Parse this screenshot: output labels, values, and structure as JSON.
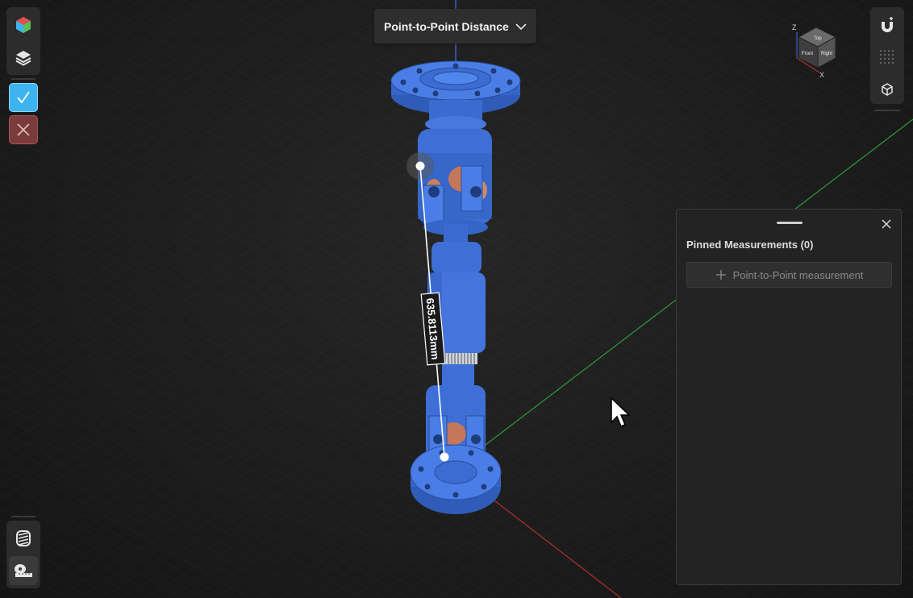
{
  "mode_dropdown": {
    "label": "Point-to-Point Distance",
    "icon": "chevron-down-icon"
  },
  "measurement": {
    "value_label": "635.8113mm"
  },
  "view_cube": {
    "axis_labels": [
      "Z",
      "X"
    ],
    "face_labels": [
      "Top",
      "Front",
      "Right"
    ]
  },
  "panel": {
    "title": "Pinned Measurements (0)",
    "add_button_label": "Point-to-Point measurement"
  },
  "colors": {
    "model_blue": "#3f73d9",
    "accent_cyan": "#3db3ef",
    "cancel_red": "#7a3b3b",
    "axis_green": "#2f9a3a",
    "axis_red": "#b03030",
    "axis_blue": "#3a5fd0"
  },
  "left_toolbar": {
    "items": [
      "appearance-cube-icon",
      "layers-icon",
      "confirm-check-icon",
      "cancel-x-icon"
    ],
    "bottom_items": [
      "section-cut-icon",
      "measure-tape-icon"
    ]
  },
  "right_toolbar": {
    "items": [
      "snap-magnet-icon",
      "grid-dots-icon",
      "isometric-view-icon"
    ]
  }
}
